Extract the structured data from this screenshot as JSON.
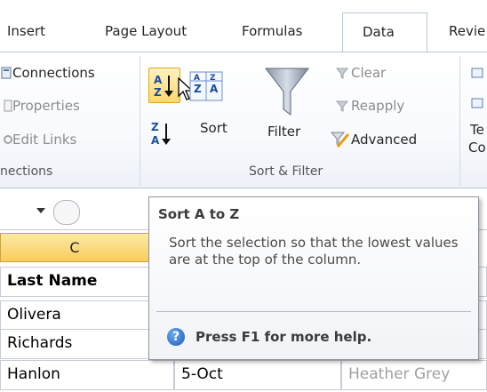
{
  "tabs": {
    "insert": "Insert",
    "page_layout": "Page Layout",
    "formulas": "Formulas",
    "data": "Data",
    "review": "Revie"
  },
  "ribbon": {
    "connections": {
      "connections": "Connections",
      "properties": "Properties",
      "edit_links": "Edit Links",
      "group_label": "nections"
    },
    "sort_filter": {
      "sort": "Sort",
      "filter": "Filter",
      "clear": "Clear",
      "reapply": "Reapply",
      "advanced": "Advanced",
      "group_label": "Sort & Filter"
    },
    "data_tools": {
      "line1": "Te",
      "line2": "Co"
    }
  },
  "grid": {
    "column_header": "C",
    "rows": [
      {
        "c": "Last Name",
        "d": "",
        "e": ""
      },
      {
        "c": "Olivera",
        "d": "",
        "e": ""
      },
      {
        "c": "Richards",
        "d": "",
        "e": ""
      },
      {
        "c": "Hanlon",
        "d": "5-Oct",
        "e": "Heather Grey"
      }
    ]
  },
  "tooltip": {
    "title": "Sort A to Z",
    "body": "Sort the selection so that the lowest values are at the top of the column.",
    "help": "Press F1 for more help."
  },
  "colors": {
    "accent_highlight": "#ffd86b",
    "help_blue": "#1d5fbd",
    "muted_text": "#a0a0a0"
  }
}
